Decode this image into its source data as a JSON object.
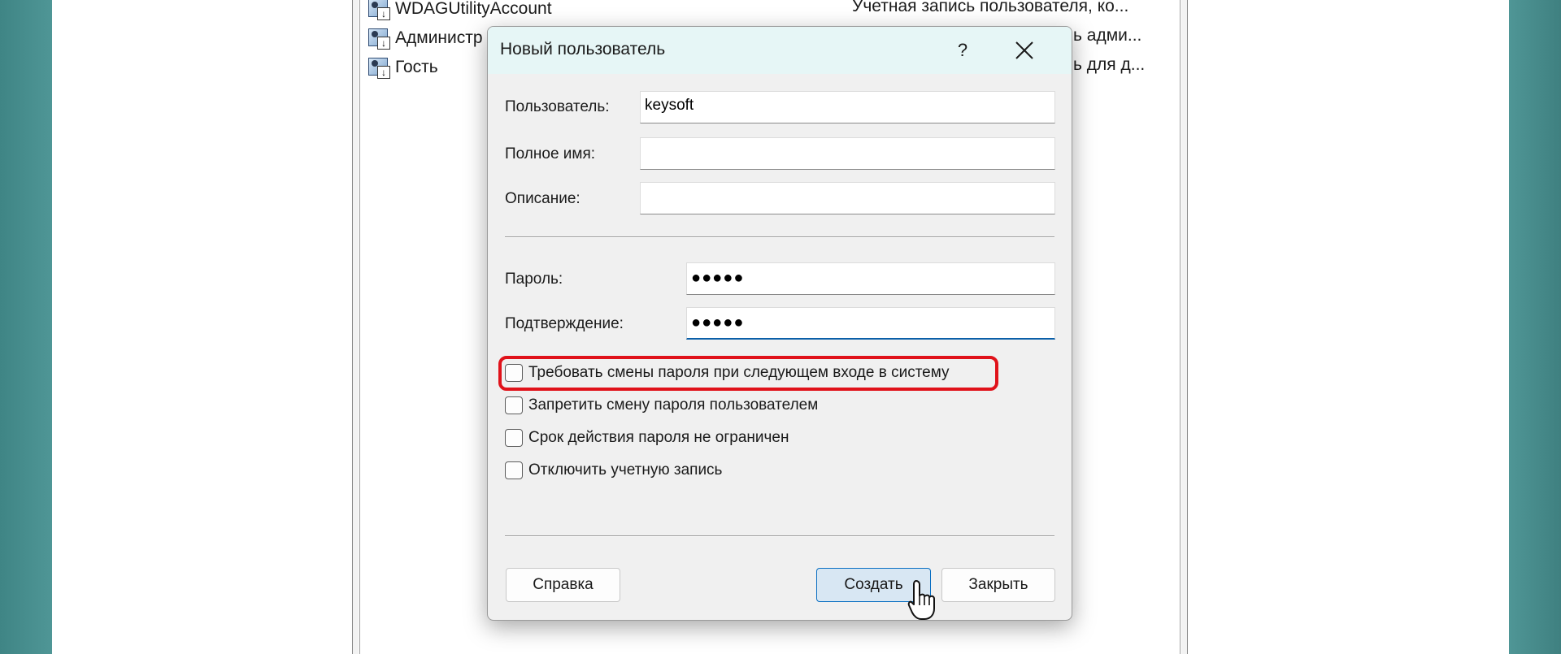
{
  "users": [
    {
      "name": "WDAGUtilityAccount",
      "description": "Учетная запись пользователя, ко..."
    },
    {
      "name": "Администр",
      "description": "ь адми..."
    },
    {
      "name": "Гость",
      "description": "ь для д..."
    }
  ],
  "dialog": {
    "title": "Новый пользователь",
    "help_label": "?",
    "fields": {
      "user_label": "Пользователь:",
      "user_value": "keysoft",
      "fullname_label": "Полное имя:",
      "fullname_value": "",
      "description_label": "Описание:",
      "description_value": "",
      "password_label": "Пароль:",
      "password_value": "●●●●●",
      "confirm_label": "Подтверждение:",
      "confirm_value": "●●●●●"
    },
    "checkboxes": [
      {
        "label": "Требовать смены пароля при следующем входе в систему",
        "checked": false,
        "highlighted": true
      },
      {
        "label": "Запретить смену пароля пользователем",
        "checked": false
      },
      {
        "label": "Срок действия пароля не ограничен",
        "checked": false
      },
      {
        "label": "Отключить учетную запись",
        "checked": false
      }
    ],
    "buttons": {
      "help": "Справка",
      "create": "Создать",
      "close": "Закрыть"
    }
  },
  "colors": {
    "highlight": "#e0121a",
    "primary_button_border": "#0a6fc2",
    "titlebar": "#e6f6f6",
    "background": "#4a8f8f"
  }
}
